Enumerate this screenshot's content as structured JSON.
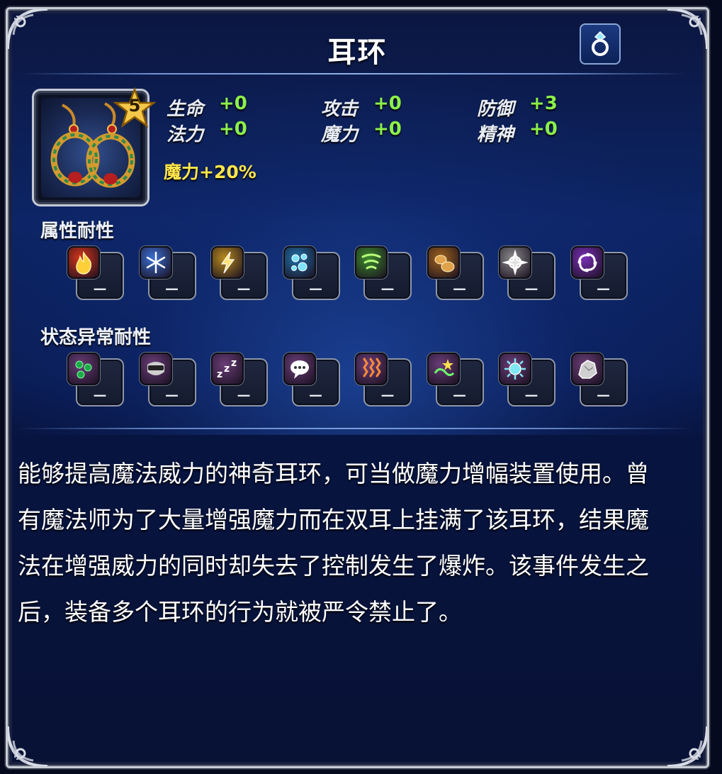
{
  "title": "耳环",
  "header": {
    "icon": "ring-icon"
  },
  "item": {
    "rarity": "5",
    "stats": [
      {
        "label": "生命",
        "value": "+0"
      },
      {
        "label": "攻击",
        "value": "+0"
      },
      {
        "label": "防御",
        "value": "+3"
      },
      {
        "label": "法力",
        "value": "+0"
      },
      {
        "label": "魔力",
        "value": "+0"
      },
      {
        "label": "精神",
        "value": "+0"
      }
    ],
    "bonus": "魔力+20%"
  },
  "elemental": {
    "label": "属性耐性",
    "items": [
      {
        "icon": "fire-icon",
        "value": "－",
        "color": "#d8351a"
      },
      {
        "icon": "ice-icon",
        "value": "－",
        "color": "#3a6fd4"
      },
      {
        "icon": "lightning-icon",
        "value": "－",
        "color": "#b78a1e"
      },
      {
        "icon": "water-icon",
        "value": "－",
        "color": "#1f6fa8"
      },
      {
        "icon": "wind-icon",
        "value": "－",
        "color": "#3c8a2c"
      },
      {
        "icon": "earth-icon",
        "value": "－",
        "color": "#a0631c"
      },
      {
        "icon": "holy-icon",
        "value": "－",
        "color": "#8a8a8a"
      },
      {
        "icon": "dark-icon",
        "value": "－",
        "color": "#7a2fb8"
      }
    ]
  },
  "status": {
    "label": "状态异常耐性",
    "items": [
      {
        "icon": "poison-icon",
        "value": "－",
        "color": "#6a3d78"
      },
      {
        "icon": "blind-icon",
        "value": "－",
        "color": "#6a3d78"
      },
      {
        "icon": "sleep-icon",
        "value": "－",
        "color": "#6a3d78"
      },
      {
        "icon": "silence-icon",
        "value": "－",
        "color": "#6a3d78"
      },
      {
        "icon": "paralyze-icon",
        "value": "－",
        "color": "#6a3d78"
      },
      {
        "icon": "confuse-icon",
        "value": "－",
        "color": "#6a3d78"
      },
      {
        "icon": "disease-icon",
        "value": "－",
        "color": "#6a3d78"
      },
      {
        "icon": "petrify-icon",
        "value": "－",
        "color": "#6a3d78"
      }
    ]
  },
  "description": [
    "能够提高魔法威力的神奇耳环，可当做魔力增幅装置使用。曾",
    "有魔法师为了大量增强魔力而在双耳上挂满了该耳环，结果魔",
    "法在增强威力的同时却失去了控制发生了爆炸。该事件发生之",
    "后，装备多个耳环的行为就被严令禁止了。"
  ]
}
